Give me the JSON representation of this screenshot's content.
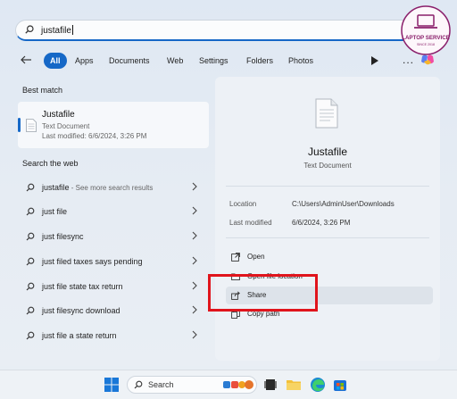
{
  "search": {
    "query": "justafile"
  },
  "filters": {
    "items": [
      "All",
      "Apps",
      "Documents",
      "Web",
      "Settings",
      "Folders",
      "Photos"
    ],
    "active": "All",
    "more_glyph": "..."
  },
  "best_match": {
    "heading": "Best match",
    "title": "Justafile",
    "type": "Text Document",
    "modified": "Last modified: 6/6/2024, 3:26 PM"
  },
  "web": {
    "heading": "Search the web",
    "items": [
      {
        "label": "justafile",
        "sub": " - See more search results"
      },
      {
        "label": "just file",
        "sub": ""
      },
      {
        "label": "just filesync",
        "sub": ""
      },
      {
        "label": "just filed taxes says pending",
        "sub": ""
      },
      {
        "label": "just file state tax return",
        "sub": ""
      },
      {
        "label": "just filesync download",
        "sub": ""
      },
      {
        "label": "just file a state return",
        "sub": ""
      }
    ]
  },
  "preview": {
    "title": "Justafile",
    "type": "Text Document",
    "location_key": "Location",
    "location_val": "C:\\Users\\AdminUser\\Downloads",
    "modified_key": "Last modified",
    "modified_val": "6/6/2024, 3:26 PM",
    "actions": [
      "Open",
      "Open file location",
      "Share",
      "Copy path"
    ]
  },
  "logo": {
    "line1": "LAPTOP SERVICE",
    "line2": "SINCE 2018"
  },
  "taskbar": {
    "search_label": "Search"
  },
  "colors": {
    "accent": "#1668c7",
    "highlight": "#e0141c"
  }
}
